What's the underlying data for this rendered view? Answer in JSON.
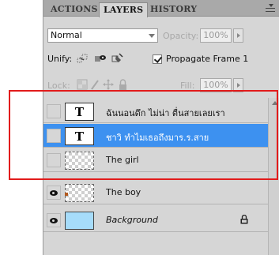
{
  "tabs": [
    {
      "label": "ACTIONS",
      "active": false
    },
    {
      "label": "LAYERS",
      "active": true
    },
    {
      "label": "HISTORY",
      "active": false
    }
  ],
  "blend": {
    "mode": "Normal",
    "opacity_label": "Opacity:",
    "opacity_value": "100%"
  },
  "unify": {
    "label": "Unify:",
    "icons": [
      "unify-position-icon",
      "unify-visibility-icon",
      "unify-style-icon"
    ],
    "propagate_label": "Propagate Frame 1",
    "propagate_checked": true
  },
  "lock": {
    "label": "Lock:",
    "icons": [
      "lock-transparent-icon",
      "lock-paint-icon",
      "lock-move-icon",
      "lock-all-icon"
    ],
    "fill_label": "Fill:",
    "fill_value": "100%"
  },
  "layers": [
    {
      "name": "ฉันนอนดึก ไม่น่า ตื่นสายเลยเรา",
      "thumb": "text",
      "thumb_glyph": "T",
      "visible": false,
      "selected": false
    },
    {
      "name": "ชาวิ ทำไมเธอถึงมาร.ร.สาย",
      "thumb": "text",
      "thumb_glyph": "T",
      "visible": false,
      "selected": true
    },
    {
      "name": "The girl",
      "thumb": "transparent",
      "visible": false,
      "selected": false
    },
    {
      "name": "The boy",
      "thumb": "transparent",
      "visible": true,
      "selected": false
    },
    {
      "name": "Background",
      "thumb": "sky",
      "visible": true,
      "selected": false,
      "locked": true
    }
  ],
  "colors": {
    "selection": "#3d91f0",
    "annotation": "#e21b1b",
    "sky": "#a6dcfa"
  }
}
